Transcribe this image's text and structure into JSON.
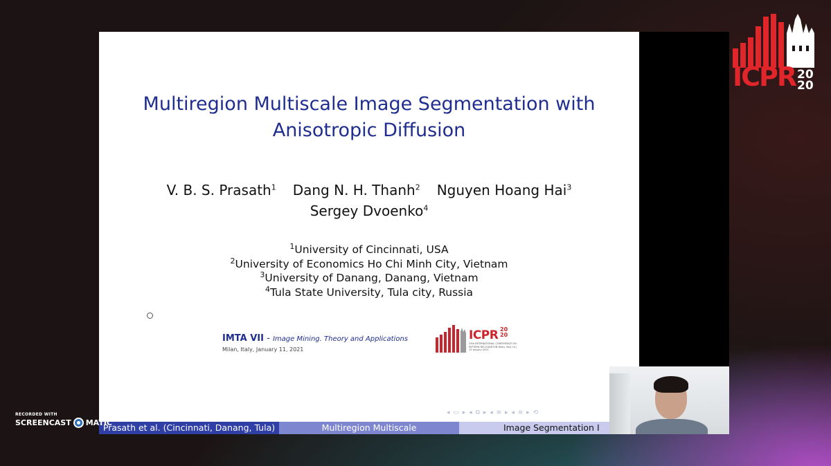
{
  "slide": {
    "title_line1": "Multiregion Multiscale Image Segmentation with",
    "title_line2": "Anisotropic Diffusion",
    "authors": [
      {
        "name": "V. B. S. Prasath",
        "affil": "1"
      },
      {
        "name": "Dang N. H. Thanh",
        "affil": "2"
      },
      {
        "name": "Nguyen Hoang Hai",
        "affil": "3"
      },
      {
        "name": "Sergey Dvoenko",
        "affil": "4"
      }
    ],
    "affiliations": [
      {
        "num": "1",
        "text": "University of Cincinnati, USA"
      },
      {
        "num": "2",
        "text": "University of Economics Ho Chi Minh City, Vietnam"
      },
      {
        "num": "3",
        "text": "University of Danang, Danang, Vietnam"
      },
      {
        "num": "4",
        "text": "Tula State University, Tula city, Russia"
      }
    ],
    "workshop": {
      "name": "IMTA VII",
      "separator": " - ",
      "subtitle": "Image Mining. Theory and Applications",
      "location_date": "Milan, Italy, January 11, 2021"
    },
    "small_logo": {
      "text": "ICPR",
      "year_top": "20",
      "year_bottom": "20",
      "caption": "25th INTERNATIONAL CONFERENCE ON PATTERN RECOGNITION Milan, Italy 10 | 15 January 2021"
    },
    "footer": {
      "left": "Prasath et al.  (Cincinnati, Danang, Tula)",
      "center": "Multiregion Multiscale",
      "right": "Image Segmentation      I"
    }
  },
  "overlay_logo": {
    "text": "ICPR",
    "year_top": "20",
    "year_bottom": "20"
  },
  "recorder": {
    "top": "RECORDED WITH",
    "left": "SCREENCAST",
    "right": "MATIC"
  },
  "colors": {
    "title_blue": "#1f2d8f",
    "icpr_red": "#e0252b",
    "footer_dark": "#2f3fa6",
    "footer_mid": "#7f86d0",
    "footer_light": "#c8cbee"
  }
}
